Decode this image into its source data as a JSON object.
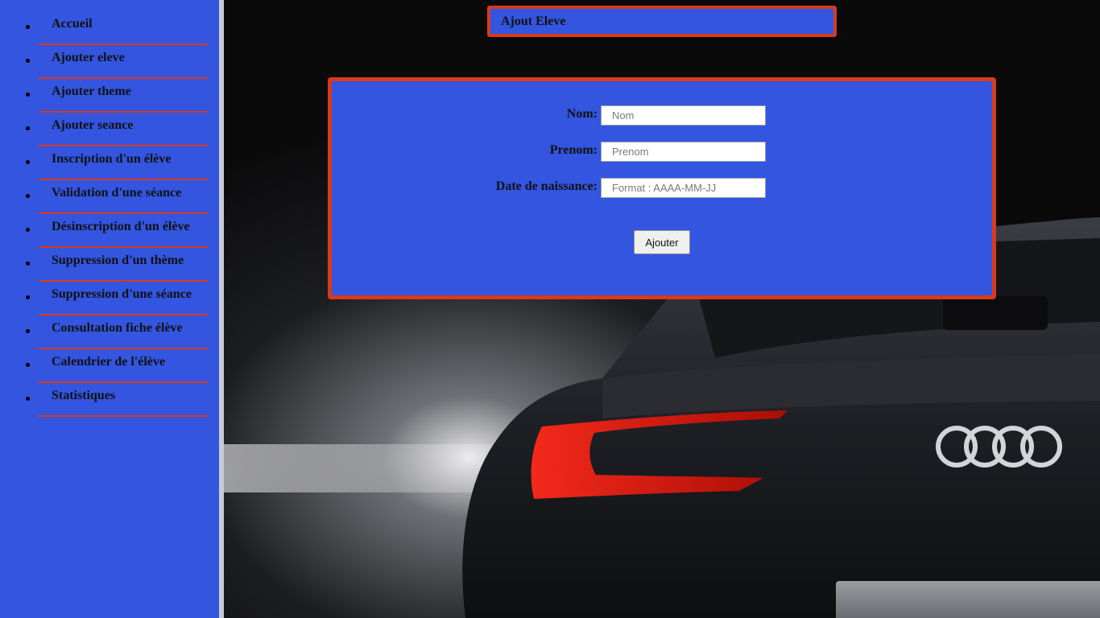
{
  "sidebar": {
    "items": [
      {
        "label": "Accueil"
      },
      {
        "label": "Ajouter eleve"
      },
      {
        "label": "Ajouter theme"
      },
      {
        "label": "Ajouter seance"
      },
      {
        "label": "Inscription d'un élève"
      },
      {
        "label": "Validation d'une séance"
      },
      {
        "label": "Désinscription d'un élève"
      },
      {
        "label": "Suppression d'un thème"
      },
      {
        "label": "Suppression d'une séance"
      },
      {
        "label": "Consultation fiche élève"
      },
      {
        "label": "Calendrier de l'élève"
      },
      {
        "label": "Statistiques"
      }
    ]
  },
  "header": {
    "title": "Ajout Eleve"
  },
  "form": {
    "fields": [
      {
        "label": "Nom:",
        "placeholder": "Nom",
        "value": ""
      },
      {
        "label": "Prenom:",
        "placeholder": "Prenom",
        "value": ""
      },
      {
        "label": "Date de naissance:",
        "placeholder": "Format : AAAA-MM-JJ",
        "value": ""
      }
    ],
    "submit_label": "Ajouter"
  },
  "colors": {
    "panel_blue": "#3355e0",
    "accent_red": "#d83a1c",
    "sidebar_edge": "#c7cbd6"
  },
  "background_image": {
    "subject": "car-rear-photo"
  }
}
